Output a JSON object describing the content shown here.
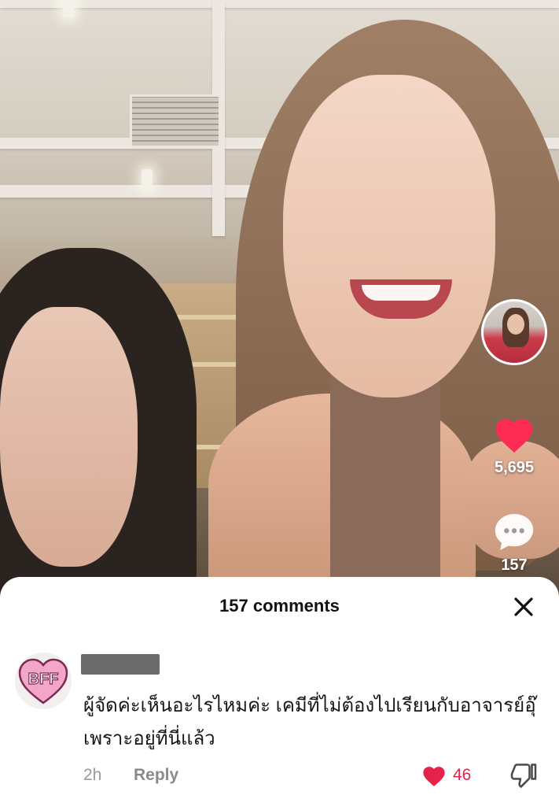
{
  "video": {
    "like_count": "5,695",
    "comment_count": "157"
  },
  "icons": {
    "like": "heart-icon",
    "comment": "comment-bubble-icon",
    "close": "close-icon",
    "dislike": "thumbs-down-icon"
  },
  "colors": {
    "like_red": "#fe2c55",
    "comment_like_red": "#e6224b",
    "meta_gray": "#9a9a9a"
  },
  "comments_panel": {
    "title": "157 comments",
    "comment": {
      "avatar_badge_text": "BFF",
      "text": "ผู้จัดค่ะเห็นอะไรไหมค่ะ เคมีที่ไม่ต้องไปเรียนกับอาจารย์อุ๊ เพราะอยู่ที่นี่แล้ว",
      "time": "2h",
      "reply_label": "Reply",
      "like_count": "46"
    }
  }
}
